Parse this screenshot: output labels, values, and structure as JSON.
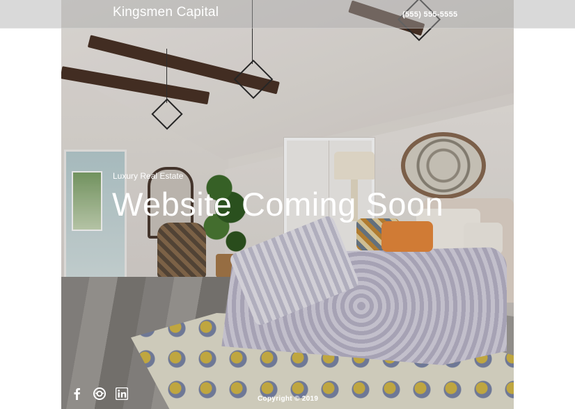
{
  "header": {
    "brand": "Kingsmen Capital",
    "phone": "(555) 555-5555"
  },
  "hero": {
    "image_icon": "bedroom-photo",
    "tagline": "Luxury Real Estate",
    "headline": "Website Coming Soon"
  },
  "footer": {
    "social": [
      {
        "icon": "facebook-icon"
      },
      {
        "icon": "instagram-icon"
      },
      {
        "icon": "linkedin-icon"
      }
    ],
    "copyright": "Copyright © 2019"
  },
  "colors": {
    "text": "#ffffff",
    "header_overlay": "#aaaaaa"
  }
}
